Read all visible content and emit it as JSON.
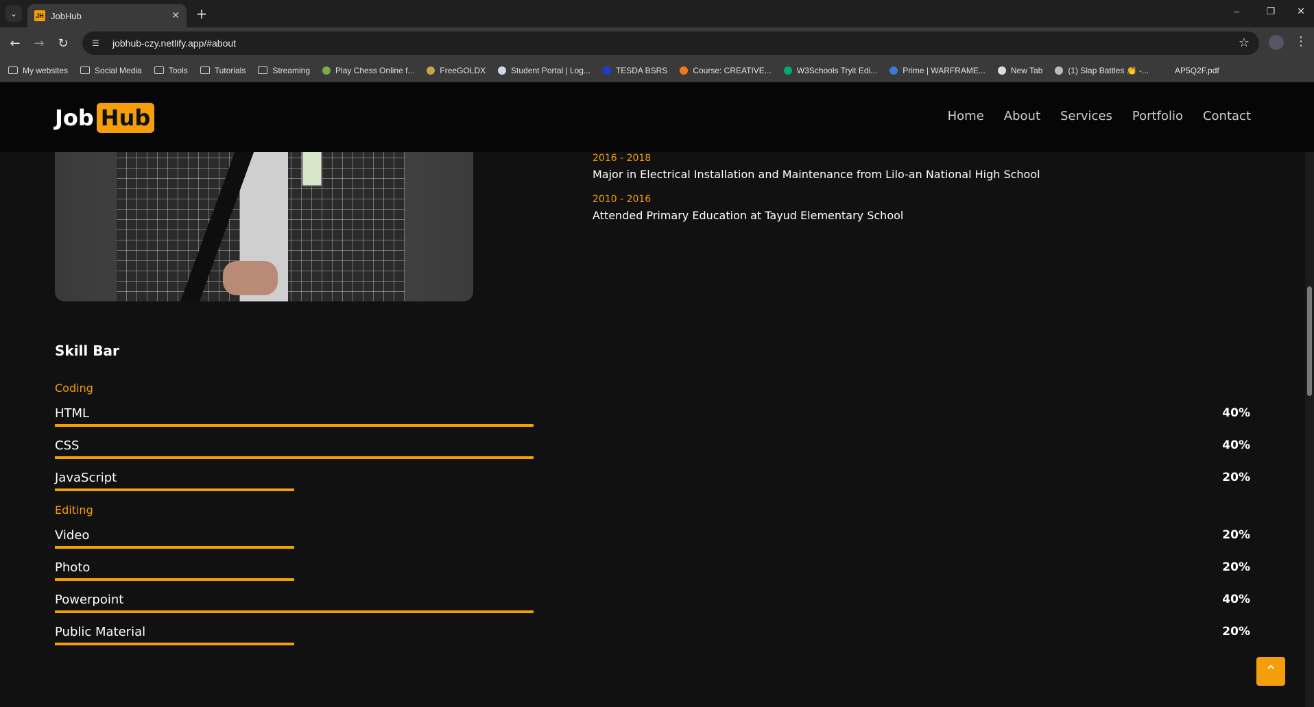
{
  "browser": {
    "tab_title": "JobHub",
    "favicon_text": "JH",
    "url": "jobhub-czy.netlify.app/#about",
    "window_controls": [
      "–",
      "❐",
      "✕"
    ]
  },
  "bookmarks": [
    {
      "label": "My websites",
      "icon": "folder"
    },
    {
      "label": "Social Media",
      "icon": "folder"
    },
    {
      "label": "Tools",
      "icon": "folder"
    },
    {
      "label": "Tutorials",
      "icon": "folder"
    },
    {
      "label": "Streaming",
      "icon": "folder"
    },
    {
      "label": "Play Chess Online f...",
      "icon": "chess",
      "color": "#7fa650"
    },
    {
      "label": "FreeGOLDX",
      "icon": "x",
      "color": "#c9a14a"
    },
    {
      "label": "Student Portal | Log...",
      "icon": "doc",
      "color": "#cfd8e6"
    },
    {
      "label": "TESDA BSRS",
      "icon": "globe",
      "color": "#1a3dcf"
    },
    {
      "label": "Course: CREATIVE...",
      "icon": "moodle",
      "color": "#f07a1a"
    },
    {
      "label": "W3Schools Tryit Edi...",
      "icon": "w3",
      "color": "#04aa6d"
    },
    {
      "label": "Prime | WARFRAME...",
      "icon": "prime",
      "color": "#3a7bd5"
    },
    {
      "label": "New Tab",
      "icon": "globe",
      "color": "#dddddd"
    },
    {
      "label": "(1) Slap Battles 👏 -...",
      "icon": "roblox",
      "color": "#bbbbbb"
    },
    {
      "label": "AP5Q2F.pdf",
      "icon": "none"
    }
  ],
  "site": {
    "logo_part1": "Job",
    "logo_part2": "Hub",
    "nav": [
      "Home",
      "About",
      "Services",
      "Portfolio",
      "Contact"
    ]
  },
  "education": [
    {
      "year": "2016 - 2018",
      "text": "Major in Electrical Installation and Maintenance from Lilo-an National High School"
    },
    {
      "year": "2010 - 2016",
      "text": "Attended Primary Education at Tayud Elementary School"
    }
  ],
  "skills_title": "Skill Bar",
  "skill_groups": [
    {
      "category": "Coding",
      "items": [
        {
          "name": "HTML",
          "percent_label": "40%",
          "level": 0.4
        },
        {
          "name": "CSS",
          "percent_label": "40%",
          "level": 0.4
        },
        {
          "name": "JavaScript",
          "percent_label": "20%",
          "level": 0.2
        }
      ]
    },
    {
      "category": "Editing",
      "items": [
        {
          "name": "Video",
          "percent_label": "20%",
          "level": 0.2
        },
        {
          "name": "Photo",
          "percent_label": "20%",
          "level": 0.2
        },
        {
          "name": "Powerpoint",
          "percent_label": "40%",
          "level": 0.4
        },
        {
          "name": "Public Material",
          "percent_label": "20%",
          "level": 0.2
        }
      ]
    }
  ],
  "colors": {
    "accent": "#f59e0b",
    "background": "#111111",
    "navbar": "#060606"
  },
  "icons": {
    "scroll_top": "chevron-up-icon"
  }
}
